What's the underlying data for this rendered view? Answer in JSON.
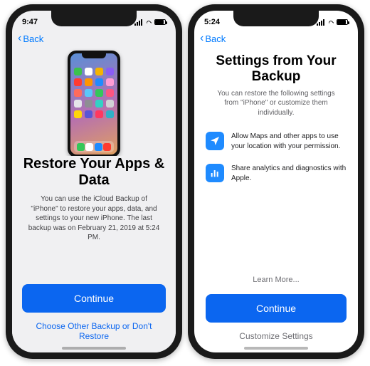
{
  "left": {
    "time": "9:47",
    "back": "Back",
    "title": "Restore Your Apps & Data",
    "desc": "You can use the iCloud Backup of \"iPhone\" to restore your apps, data, and settings to your new iPhone. The last backup was on February 21, 2019 at 5:24 PM.",
    "continue": "Continue",
    "choose_other": "Choose Other Backup or Don't Restore",
    "mini_icons": [
      "#3cc24c",
      "#ffffff",
      "#f5b400",
      "#8a5cf6",
      "#ff3b30",
      "#ff9500",
      "#1f8bff",
      "#ff9cd6",
      "#ff6b5c",
      "#5ac8fa",
      "#34c759",
      "#ff5580",
      "#e5e5ea",
      "#8e8e93",
      "#32d1c4",
      "#d1d1d6",
      "#ffd60a",
      "#5856d6",
      "#ff375f",
      "#30b0c7"
    ],
    "dock": [
      "#34c759",
      "#ffffff",
      "#1f8bff",
      "#ff3b30"
    ]
  },
  "right": {
    "time": "5:24",
    "back": "Back",
    "title": "Settings from Your Backup",
    "desc": "You can restore the following settings from \"iPhone\" or customize them individually.",
    "opt_location": "Allow Maps and other apps to use your location with your permission.",
    "opt_analytics": "Share analytics and diagnostics with Apple.",
    "learn_more": "Learn More...",
    "continue": "Continue",
    "customize": "Customize Settings"
  }
}
